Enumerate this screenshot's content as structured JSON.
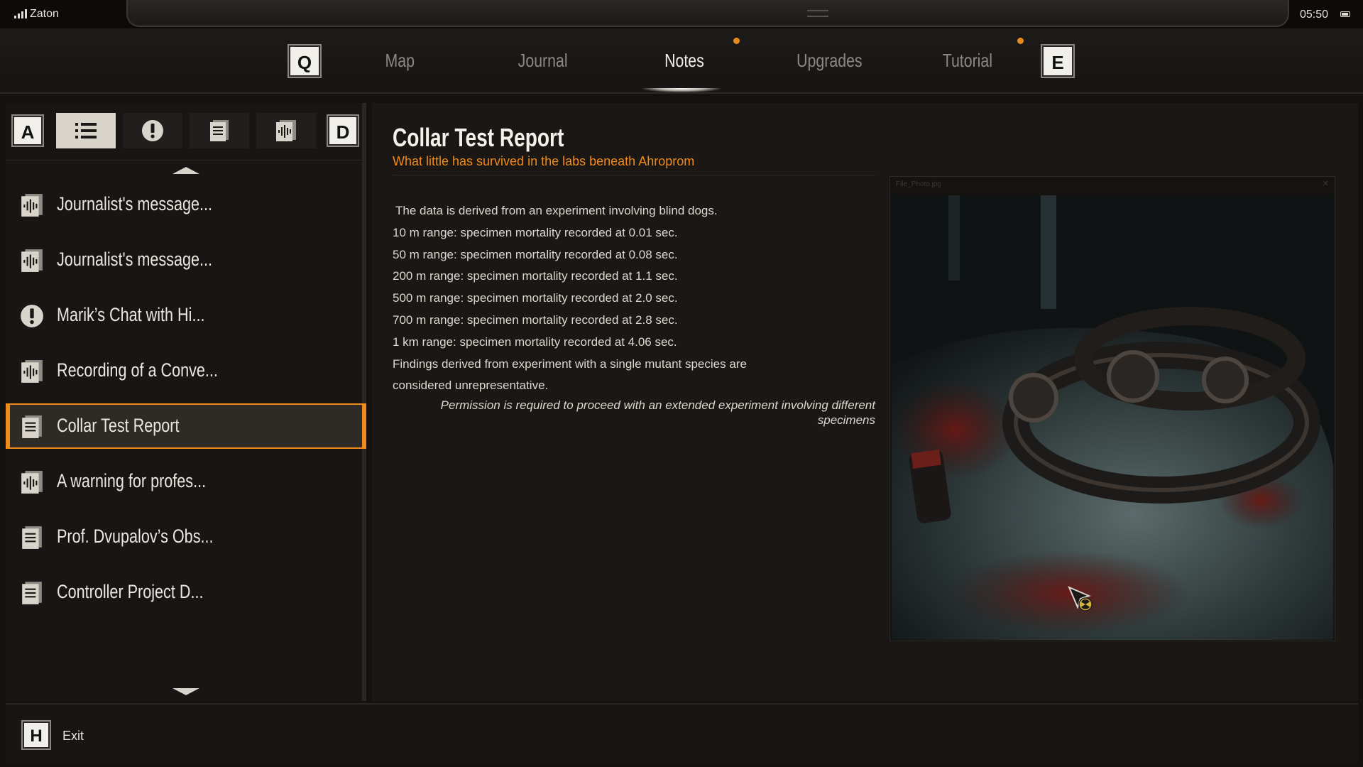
{
  "status": {
    "location": "Zaton",
    "time": "05:50"
  },
  "tabs": {
    "prev_key": "Q",
    "next_key": "E",
    "items": [
      {
        "label": "Map",
        "active": false,
        "notify": false
      },
      {
        "label": "Journal",
        "active": false,
        "notify": false
      },
      {
        "label": "Notes",
        "active": true,
        "notify": true
      },
      {
        "label": "Upgrades",
        "active": false,
        "notify": false
      },
      {
        "label": "Tutorial",
        "active": false,
        "notify": true
      }
    ]
  },
  "filters": {
    "prev_key": "A",
    "next_key": "D",
    "items": [
      {
        "icon": "list-icon",
        "active": true
      },
      {
        "icon": "exclamation-icon",
        "active": false
      },
      {
        "icon": "document-icon",
        "active": false
      },
      {
        "icon": "audio-recording-icon",
        "active": false
      }
    ]
  },
  "notes": [
    {
      "label": "Journalist's message...",
      "icon": "audio-recording-icon",
      "selected": false
    },
    {
      "label": "Journalist's message...",
      "icon": "audio-recording-icon",
      "selected": false
    },
    {
      "label": "Marik’s Chat with Hi...",
      "icon": "exclamation-icon",
      "selected": false
    },
    {
      "label": "Recording of a Conve...",
      "icon": "audio-recording-icon",
      "selected": false
    },
    {
      "label": "Collar Test Report",
      "icon": "document-icon",
      "selected": true
    },
    {
      "label": "A warning for profes...",
      "icon": "audio-recording-icon",
      "selected": false
    },
    {
      "label": "Prof. Dvupalov’s Obs...",
      "icon": "document-icon",
      "selected": false
    },
    {
      "label": "Controller Project D...",
      "icon": "document-icon",
      "selected": false
    }
  ],
  "detail": {
    "title": "Collar Test Report",
    "subtitle": "What little has survived in the labs beneath Ahroprom",
    "lines": [
      "The data is derived from an experiment involving blind dogs.",
      "10 m range: specimen mortality recorded at 0.01 sec.",
      "50 m range: specimen mortality recorded at 0.08 sec.",
      "200 m range: specimen mortality recorded at 1.1 sec.",
      "500 m range: specimen mortality recorded at 2.0 sec.",
      "700 m range: specimen mortality recorded at 2.8 sec.",
      "1 km range: specimen mortality recorded at 4.06 sec.",
      "Findings derived from experiment with a single mutant species are",
      "considered unrepresentative."
    ],
    "note": "Permission is required to proceed with an extended experiment involving different specimens",
    "photo_filename": "File_Photo.jpg"
  },
  "footer": {
    "key": "H",
    "label": "Exit"
  },
  "colors": {
    "accent": "#f08a1a",
    "background": "#141210",
    "panel": "#181615"
  }
}
